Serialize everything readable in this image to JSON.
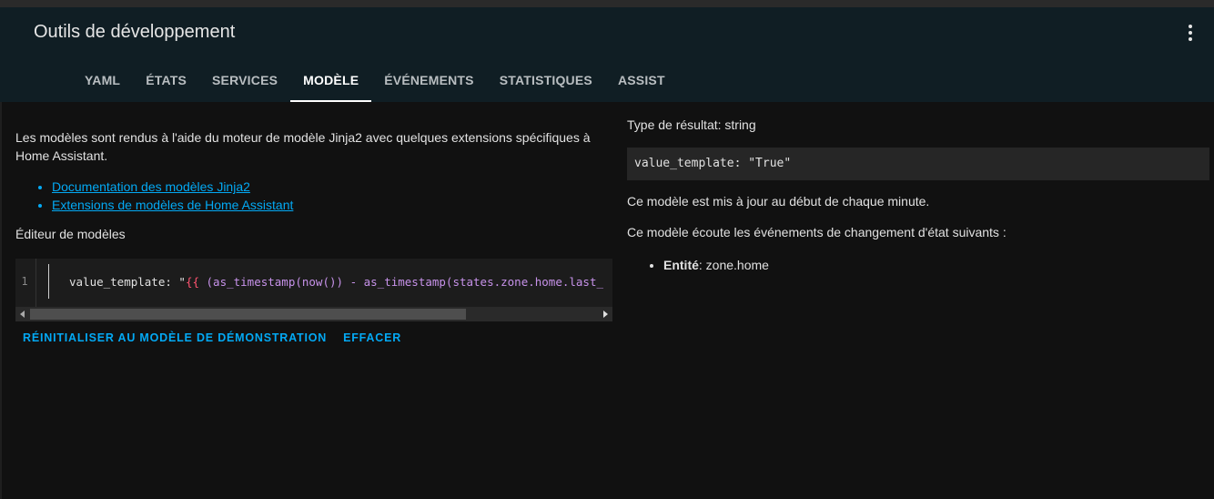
{
  "header": {
    "title": "Outils de développement",
    "menu_icon": "more-vertical-icon",
    "tabs": [
      {
        "label": "YAML",
        "active": false
      },
      {
        "label": "ÉTATS",
        "active": false
      },
      {
        "label": "SERVICES",
        "active": false
      },
      {
        "label": "MODÈLE",
        "active": true
      },
      {
        "label": "ÉVÉNEMENTS",
        "active": false
      },
      {
        "label": "STATISTIQUES",
        "active": false
      },
      {
        "label": "ASSIST",
        "active": false
      }
    ]
  },
  "left": {
    "intro": "Les modèles sont rendus à l'aide du moteur de modèle Jinja2 avec quelques extensions spécifiques à Home Assistant.",
    "links": [
      "Documentation des modèles Jinja2",
      "Extensions de modèles de Home Assistant"
    ],
    "editor_label": "Éditeur de modèles",
    "editor": {
      "line_number": "1",
      "code_key": "value_template: \"",
      "code_brace": "{{",
      "code_rest": " (as_timestamp(now()) - as_timestamp(states.zone.home.last_"
    },
    "actions": {
      "reset": "RÉINITIALISER AU MODÈLE DE DÉMONSTRATION",
      "clear": "EFFACER"
    }
  },
  "right": {
    "result_type": "Type de résultat: string",
    "result_value": "value_template: \"True\"",
    "update_note": "Ce modèle est mis à jour au début de chaque minute.",
    "listen_note": "Ce modèle écoute les événements de changement d'état suivants :",
    "entity_label": "Entité",
    "entity_value": ": zone.home"
  },
  "colors": {
    "background": "#111111",
    "header": "#101e24",
    "accent": "#03a9f4"
  }
}
